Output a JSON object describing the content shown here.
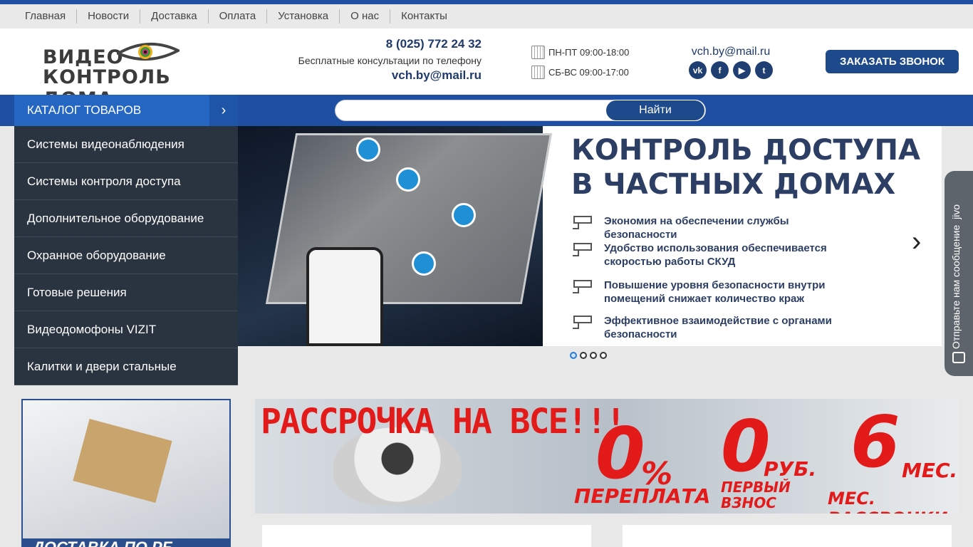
{
  "topnav": {
    "items": [
      "Главная",
      "Новости",
      "Доставка",
      "Оплата",
      "Установка",
      "О нас",
      "Контакты"
    ]
  },
  "header": {
    "logo_line1": "ВИДЕО",
    "logo_line2": "КОНТРОЛЬ ДОМА",
    "phone": "8 (025) 772 24 32",
    "consult": "Бесплатные консультации по телефону",
    "email": "vch.by@mail.ru",
    "hours_weekday": "ПН-ПТ 09:00-18:00",
    "hours_weekend": "СБ-ВС 09:00-17:00",
    "email2": "vch.by@mail.ru",
    "callback_button": "ЗАКАЗАТЬ ЗВОНОК",
    "social": [
      "vk-icon",
      "facebook-icon",
      "youtube-icon",
      "twitter-icon"
    ]
  },
  "catalog": {
    "label": "КАТАЛОГ ТОВАРОВ",
    "arrow": "›",
    "items": [
      "Системы видеонаблюдения",
      "Системы контроля доступа",
      "Дополнительное оборудование",
      "Охранное оборудование",
      "Готовые решения",
      "Видеодомофоны VIZIT",
      "Калитки и двери стальные"
    ]
  },
  "search": {
    "value": "",
    "placeholder": "",
    "button": "Найти"
  },
  "slider": {
    "title_line1": "КОНТРОЛЬ ДОСТУПА",
    "title_line2": "В ЧАСТНЫХ ДОМАХ",
    "features": [
      "Экономия на обеспечении службы безопасности",
      "Удобство использования обеспечивается скоростью работы СКУД",
      "Повышение уровня безопасности внутри помещений снижает количество краж",
      "Эффективное взаимодействие с органами безопасности"
    ],
    "next": "›",
    "dots_total": 4,
    "dots_active": 1
  },
  "delivery_banner": {
    "text": "ДОСТАВКА ПО РБ"
  },
  "promo": {
    "headline": "РАССРОЧКА НА ВСЕ!!!",
    "pct": "0",
    "pct_sign": "%",
    "pct_label": "ПЕРЕПЛАТА",
    "zero": "0",
    "rub": "РУБ.",
    "first": "ПЕРВЫЙ",
    "payment": "ВЗНОС",
    "six": "6",
    "months": "МЕС.",
    "months_label": "МЕС. РАССРОЧКИ"
  },
  "jivo": {
    "label": "Отправьте нам сообщение",
    "brand": "jivo"
  },
  "colors": {
    "primary": "#1e4fa3",
    "dark_menu": "#2a3340",
    "button": "#1e4a8c",
    "accent_red": "#e21a1a"
  }
}
